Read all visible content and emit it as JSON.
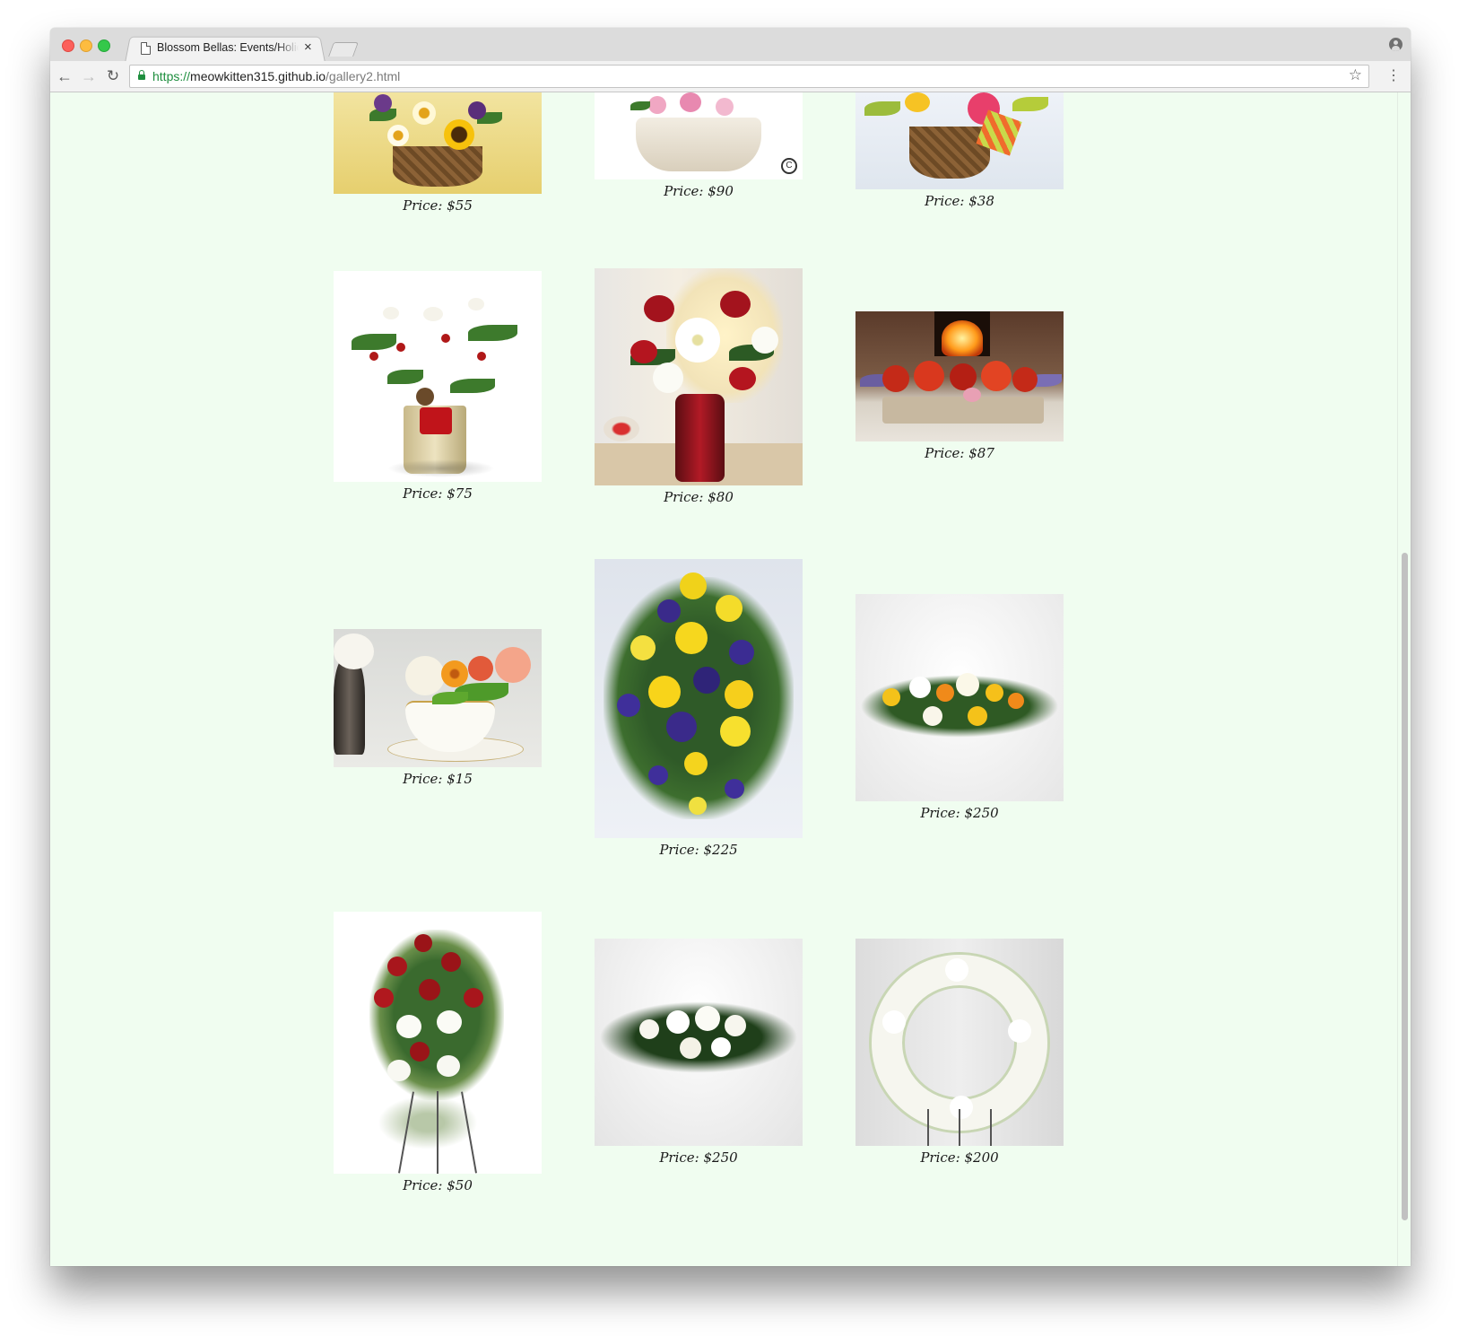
{
  "browser": {
    "tab_title": "Blossom Bellas: Events/Holidays",
    "url_scheme": "https://",
    "url_host": "meowkitten315.github.io",
    "url_path": "/gallery2.html"
  },
  "gallery": {
    "items": [
      {
        "price": "Price: $55",
        "image": "sunflower-basket"
      },
      {
        "price": "Price: $90",
        "image": "pink-roses-basket"
      },
      {
        "price": "Price: $38",
        "image": "rose-basket-ribbon"
      },
      {
        "price": "Price: $75",
        "image": "holiday-berries-vase"
      },
      {
        "price": "Price: $80",
        "image": "red-roses-lilies-vase"
      },
      {
        "price": "Price: $87",
        "image": "fireplace-centerpiece"
      },
      {
        "price": "Price: $15",
        "image": "teacup-arrangement"
      },
      {
        "price": "Price: $225",
        "image": "yellow-purple-spray"
      },
      {
        "price": "Price: $250",
        "image": "casket-spray-yellow"
      },
      {
        "price": "Price: $50",
        "image": "standing-spray-red-white"
      },
      {
        "price": "Price: $250",
        "image": "casket-spray-white"
      },
      {
        "price": "Price: $200",
        "image": "white-wreath-stand"
      }
    ]
  },
  "colors": {
    "page_background": "#f0fdf0",
    "secure_green": "#1e8e3e"
  }
}
